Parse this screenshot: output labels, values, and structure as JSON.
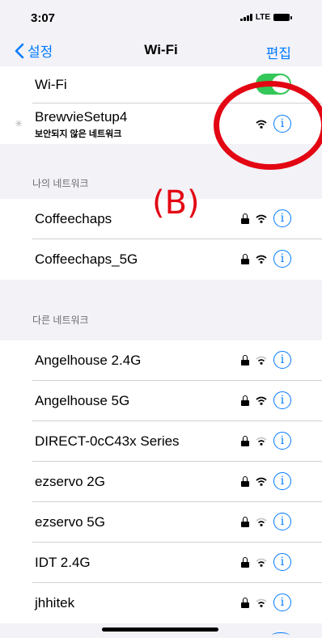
{
  "status": {
    "time": "3:07",
    "network": "LTE"
  },
  "nav": {
    "back_label": "설정",
    "title": "Wi-Fi",
    "edit_label": "편집"
  },
  "wifi_toggle": {
    "label": "Wi-Fi",
    "on": true
  },
  "connecting": {
    "name": "BrewvieSetup4",
    "subtitle": "보안되지 않은 네트워크"
  },
  "my_networks": {
    "header": "나의 네트워크",
    "items": [
      {
        "name": "Coffeechaps",
        "locked": true
      },
      {
        "name": "Coffeechaps_5G",
        "locked": true
      }
    ]
  },
  "other_networks": {
    "header": "다른 네트워크",
    "items": [
      {
        "name": "Angelhouse 2.4G",
        "locked": true
      },
      {
        "name": "Angelhouse 5G",
        "locked": true
      },
      {
        "name": "DIRECT-0cC43x Series",
        "locked": true
      },
      {
        "name": "ezservo 2G",
        "locked": true
      },
      {
        "name": "ezservo 5G",
        "locked": true
      },
      {
        "name": "IDT 2.4G",
        "locked": true
      },
      {
        "name": "jhhitek",
        "locked": true
      }
    ]
  },
  "annotation": {
    "label": "(B)",
    "color": "#e30613"
  },
  "colors": {
    "accent": "#007aff",
    "toggle_on": "#34c759"
  }
}
